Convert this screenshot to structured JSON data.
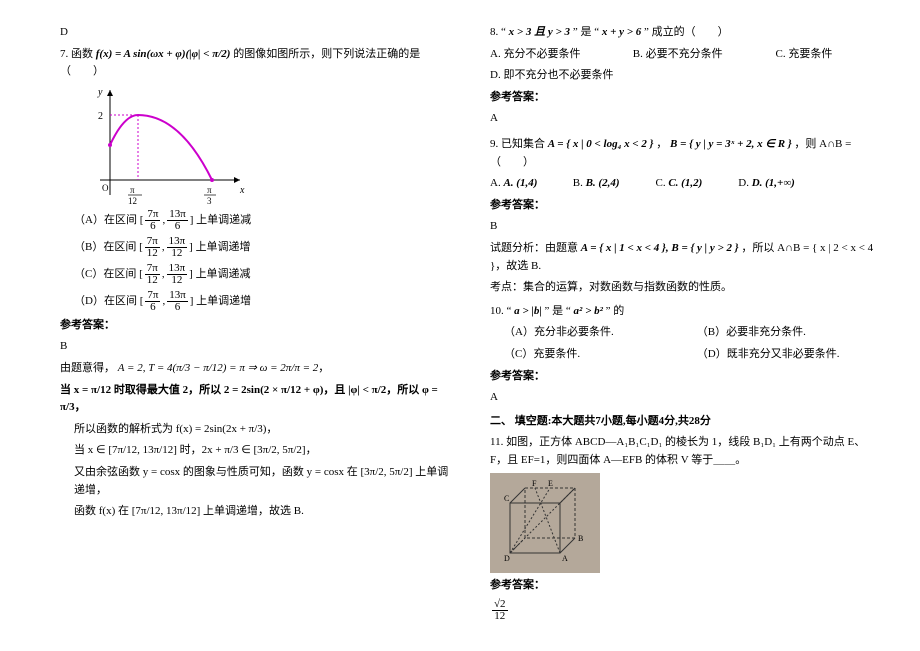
{
  "left": {
    "label_D": "D",
    "q7_prefix": "7. 函数",
    "q7_func": "f(x) = A sin(ωx + φ)(|φ| < π/2)",
    "q7_suffix": "的图像如图所示，则下列说法正确的是（　　）",
    "optA_prefix": "（A）在区间",
    "optA_int": "[7π/6, 13π/6]",
    "optA_suffix": "上单调递减",
    "optB_prefix": "（B）在区间",
    "optB_int": "[7π/12, 13π/12]",
    "optB_suffix": "上单调递增",
    "optC_prefix": "（C）在区间",
    "optC_int": "[7π/12, 13π/12]",
    "optC_suffix": "上单调递减",
    "optD_prefix": "（D）在区间",
    "optD_int": "[7π/6, 13π/6]",
    "optD_suffix": "上单调递增",
    "ans_label": "参考答案：",
    "ans7": "B",
    "expl1_a": "由题意得，",
    "expl1_b": "A = 2, T = 4(π/3 − π/12) = π ⇒ ω = 2π/π = 2",
    "expl2": "当 x = π/12 时取得最大值 2，所以 2 = 2sin(2 × π/12 + φ)，且 |φ| < π/2，所以 φ = π/3，",
    "expl3": "所以函数的解析式为 f(x) = 2sin(2x + π/3)，",
    "expl4": "当 x ∈ [7π/12, 13π/12] 时，2x + π/3 ∈ [3π/2, 5π/2]，",
    "expl5": "又由余弦函数 y = cosx 的图象与性质可知，函数 y = cosx 在 [3π/2, 5π/2] 上单调递增，",
    "expl6": "函数 f(x) 在 [7π/12, 13π/12] 上单调递增，故选 B."
  },
  "right": {
    "q8_a": "8. “",
    "q8_cond1": "x > 3 且 y > 3",
    "q8_b": "” 是 “",
    "q8_cond2": "x + y > 6",
    "q8_c": "” 成立的（　　）",
    "q8_optA": "A. 充分不必要条件",
    "q8_optB": "B. 必要不充分条件",
    "q8_optC": "C. 充要条件",
    "q8_optD": "D. 即不充分也不必要条件",
    "ans_label": "参考答案：",
    "ans8": "A",
    "q9_a": "9. 已知集合",
    "q9_setA": "A = { x | 0 < log₄ x < 2 }",
    "q9_sep": "，",
    "q9_setB": "B = { y | y = 3ˣ + 2, x ∈ R }",
    "q9_b": "，则 A∩B =（　　）",
    "q9_optA": "A. (1,4)",
    "q9_optB": "B. (2,4)",
    "q9_optC": "C. (1,2)",
    "q9_optD": "D. (1,+∞)",
    "ans9": "B",
    "q9_expl_a": "试题分析：由题意",
    "q9_expl_sets": "A = { x | 1 < x < 4 }, B = { y | y > 2 }",
    "q9_expl_b": "，所以 A∩B = { x | 2 < x < 4 }，故选 B.",
    "q9_kaodian": "考点：集合的运算，对数函数与指数函数的性质。",
    "q10_a": "10. “",
    "q10_cond1": "a > |b|",
    "q10_b": "” 是 “",
    "q10_cond2": "a² > b²",
    "q10_c": "” 的",
    "q10_optA": "（A）充分非必要条件.",
    "q10_optB": "（B）必要非充分条件.",
    "q10_optC": "（C）充要条件.",
    "q10_optD": "（D）既非充分又非必要条件.",
    "ans10": "A",
    "section2": "二、 填空题:本大题共7小题,每小题4分,共28分",
    "q11": "11. 如图，正方体 ABCD—A₁B₁C₁D₁ 的棱长为 1，线段 B₁D₁ 上有两个动点 E、F，且 EF=1，则四面体 A—EFB 的体积 V 等于＿＿。",
    "ans11": "√2 / 12"
  }
}
